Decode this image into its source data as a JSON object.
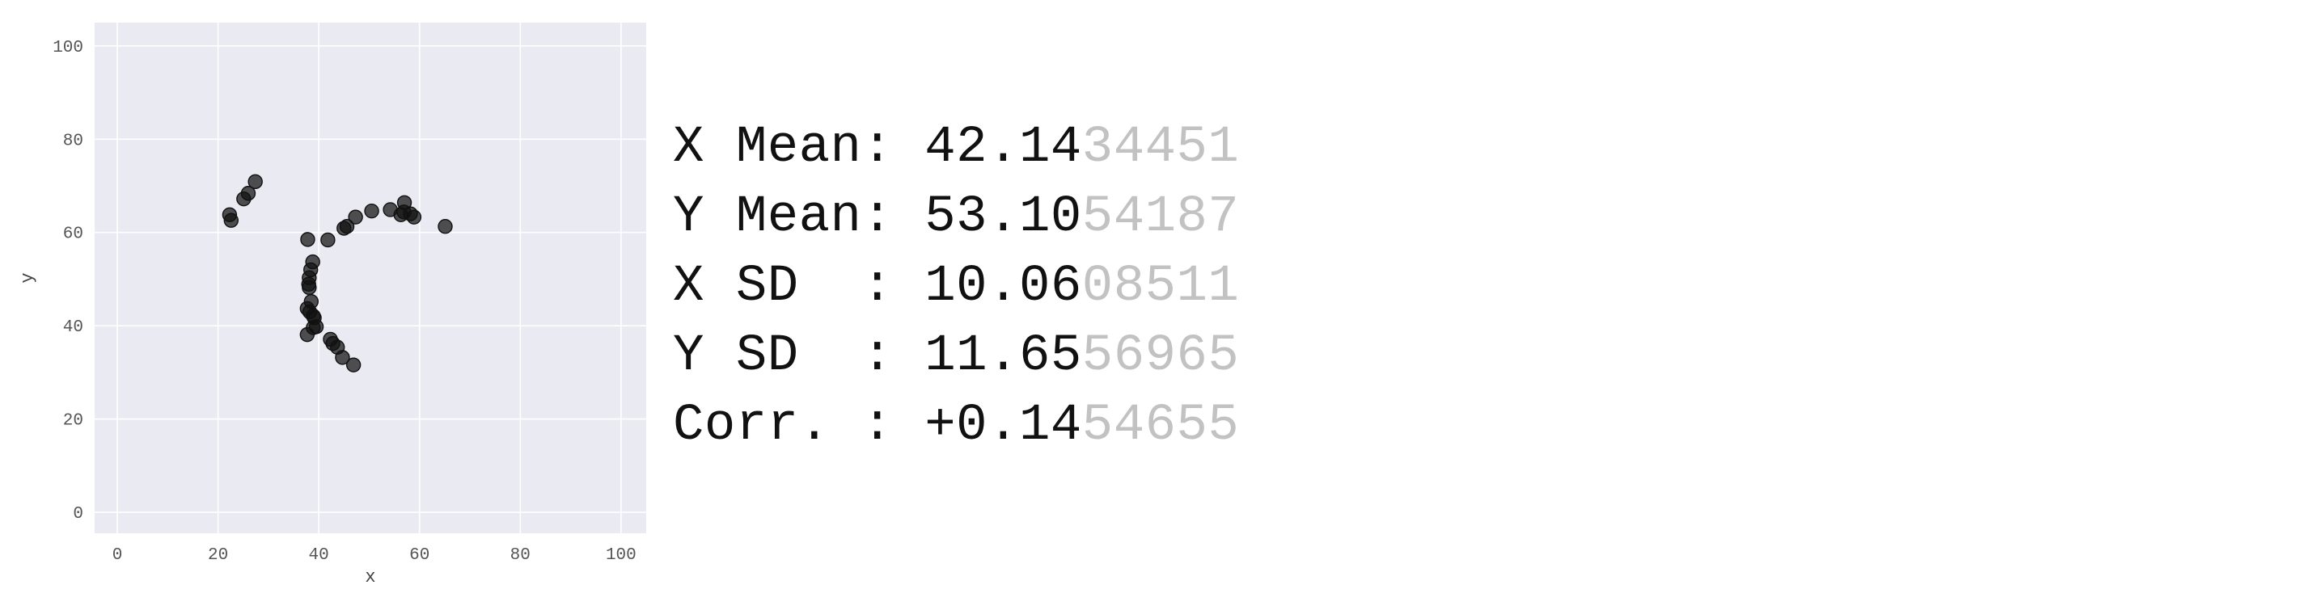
{
  "chart_data": {
    "type": "scatter",
    "xlabel": "x",
    "ylabel": "y",
    "xlim": [
      -4.5,
      105
    ],
    "ylim": [
      -4.5,
      105
    ],
    "xticks": [
      0,
      20,
      40,
      60,
      80,
      100
    ],
    "yticks": [
      0,
      20,
      40,
      60,
      80,
      100
    ],
    "grid": true,
    "point_color": "#111111",
    "background_color": "#eaeaf2",
    "points": [
      {
        "x": 22.3,
        "y": 63.8
      },
      {
        "x": 22.6,
        "y": 62.6
      },
      {
        "x": 25.1,
        "y": 67.2
      },
      {
        "x": 26.0,
        "y": 68.4
      },
      {
        "x": 27.4,
        "y": 70.9
      },
      {
        "x": 37.8,
        "y": 58.5
      },
      {
        "x": 41.8,
        "y": 58.4
      },
      {
        "x": 45.0,
        "y": 60.9
      },
      {
        "x": 45.6,
        "y": 61.3
      },
      {
        "x": 47.3,
        "y": 63.3
      },
      {
        "x": 50.5,
        "y": 64.6
      },
      {
        "x": 54.2,
        "y": 64.9
      },
      {
        "x": 56.3,
        "y": 63.8
      },
      {
        "x": 56.9,
        "y": 64.4
      },
      {
        "x": 57.0,
        "y": 66.4
      },
      {
        "x": 58.2,
        "y": 64.0
      },
      {
        "x": 58.9,
        "y": 63.3
      },
      {
        "x": 65.1,
        "y": 61.3
      },
      {
        "x": 38.8,
        "y": 53.7
      },
      {
        "x": 38.4,
        "y": 52.0
      },
      {
        "x": 38.1,
        "y": 50.3
      },
      {
        "x": 38.0,
        "y": 48.9
      },
      {
        "x": 38.1,
        "y": 48.2
      },
      {
        "x": 38.5,
        "y": 45.2
      },
      {
        "x": 37.7,
        "y": 43.7
      },
      {
        "x": 38.2,
        "y": 43.0
      },
      {
        "x": 38.9,
        "y": 42.1
      },
      {
        "x": 39.1,
        "y": 41.7
      },
      {
        "x": 39.5,
        "y": 39.8
      },
      {
        "x": 38.9,
        "y": 39.6
      },
      {
        "x": 37.7,
        "y": 38.1
      },
      {
        "x": 42.3,
        "y": 37.1
      },
      {
        "x": 42.8,
        "y": 36.2
      },
      {
        "x": 43.7,
        "y": 35.4
      },
      {
        "x": 44.7,
        "y": 33.2
      },
      {
        "x": 46.9,
        "y": 31.6
      }
    ]
  },
  "stats": [
    {
      "label": "X Mean: ",
      "value": "42.14",
      "faded": "34451"
    },
    {
      "label": "Y Mean: ",
      "value": "53.10",
      "faded": "54187"
    },
    {
      "label": "X SD  : ",
      "value": "10.06",
      "faded": "08511"
    },
    {
      "label": "Y SD  : ",
      "value": "11.65",
      "faded": "56965"
    },
    {
      "label": "Corr. : ",
      "value": "+0.14",
      "faded": "54655"
    }
  ]
}
